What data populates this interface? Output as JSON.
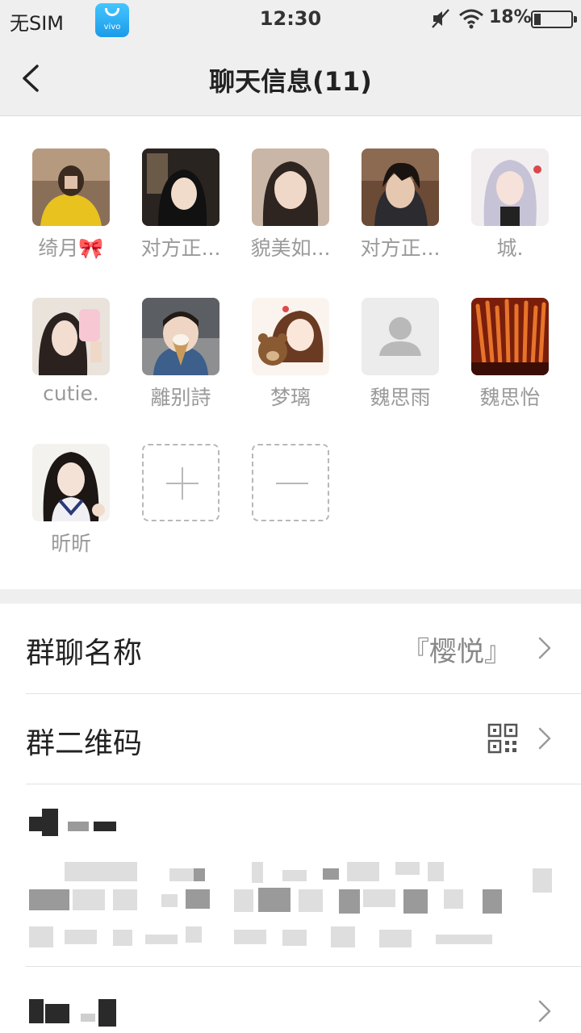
{
  "status_bar": {
    "carrier": "无SIM",
    "app_badge": "vivo",
    "time": "12:30",
    "battery_percent": "18%",
    "battery_level": 0.18
  },
  "header": {
    "title": "聊天信息(11)",
    "back_icon": "chevron-left-icon"
  },
  "members": [
    {
      "name": "绮月🎀"
    },
    {
      "name": "对方正..."
    },
    {
      "name": "貌美如..."
    },
    {
      "name": "对方正..."
    },
    {
      "name": "城."
    },
    {
      "name": "cutie."
    },
    {
      "name": "離别詩"
    },
    {
      "name": "梦璃"
    },
    {
      "name": "魏思雨"
    },
    {
      "name": "魏思怡"
    },
    {
      "name": "昕昕"
    }
  ],
  "member_actions": {
    "add_icon": "plus-icon",
    "remove_icon": "minus-icon"
  },
  "settings": {
    "group_name_label": "群聊名称",
    "group_name_value": "『樱悦』",
    "group_qr_label": "群二维码",
    "qr_icon": "qr-code-icon",
    "chevron_icon": "chevron-right-icon"
  },
  "colors": {
    "header_bg": "#efefef",
    "name_text": "#9a9a9a",
    "label_text": "#222222"
  }
}
